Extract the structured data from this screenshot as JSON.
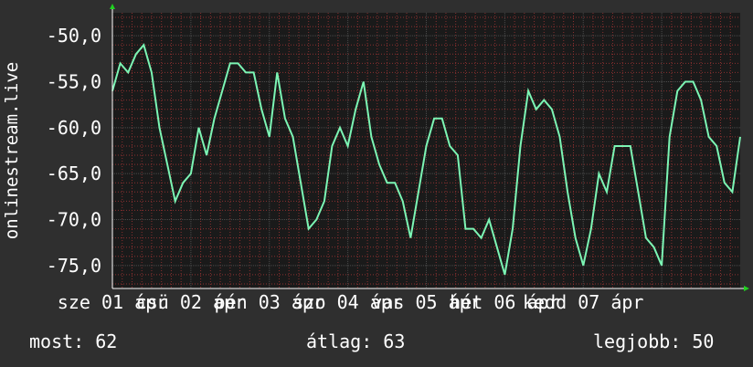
{
  "ylabel": "onlinestream.live",
  "footer": {
    "current": "most: 62",
    "average": "átlag: 63",
    "best": "legjobb: 50"
  },
  "colors": {
    "background": "#2f2f2f",
    "plot_background": "#1a1a1a",
    "line": "#7cf5b4",
    "grid_major": "#4a4a4a",
    "grid_minor": "#8a3030",
    "axis_arrow": "#20d020"
  },
  "chart_data": {
    "type": "line",
    "title": "",
    "xlabel": "",
    "ylabel": "onlinestream.live",
    "ylim": [
      -77.5,
      -47.5
    ],
    "yticks": [
      -50,
      -55,
      -60,
      -65,
      -70,
      -75
    ],
    "ytick_labels": [
      "-50,0",
      "-55,0",
      "-60,0",
      "-65,0",
      "-70,0",
      "-75,0"
    ],
    "xlim": [
      0,
      8
    ],
    "xticks": [
      0,
      1,
      2,
      3,
      4,
      5,
      6,
      7
    ],
    "xtick_labels": [
      "sze 01 ápr",
      "csü 02 ápr",
      "pén 03 ápr",
      "szo 04 ápr",
      "vas 05 ápr",
      "hét 06 ápr",
      "kedd 07 ápr"
    ],
    "grid": true,
    "legend": "none",
    "series": [
      {
        "x": [
          0,
          0.1,
          0.2,
          0.3,
          0.4,
          0.5,
          0.6,
          0.7,
          0.8,
          0.9,
          1.0,
          1.1,
          1.2,
          1.3,
          1.4,
          1.5,
          1.6,
          1.7,
          1.8,
          1.9,
          2.0,
          2.1,
          2.2,
          2.3,
          2.4,
          2.5,
          2.6,
          2.7,
          2.8,
          2.9,
          3.0,
          3.1,
          3.2,
          3.3,
          3.4,
          3.5,
          3.6,
          3.7,
          3.8,
          3.9,
          4.0,
          4.1,
          4.2,
          4.3,
          4.4,
          4.5,
          4.6,
          4.7,
          4.8,
          4.9,
          5.0,
          5.1,
          5.2,
          5.3,
          5.4,
          5.5,
          5.6,
          5.7,
          5.8,
          5.9,
          6.0,
          6.1,
          6.2,
          6.3,
          6.4,
          6.5,
          6.6,
          6.7,
          6.8,
          6.9,
          7.0,
          7.1,
          7.2,
          7.3,
          7.4,
          7.5,
          7.6,
          7.7,
          7.8,
          7.9,
          8.0
        ],
        "values": [
          -56,
          -53,
          -54,
          -52,
          -51,
          -54,
          -60,
          -64,
          -68,
          -66,
          -65,
          -60,
          -63,
          -59,
          -56,
          -53,
          -53,
          -54,
          -54,
          -58,
          -61,
          -54,
          -59,
          -61,
          -66,
          -71,
          -70,
          -68,
          -62,
          -60,
          -62,
          -58,
          -55,
          -61,
          -64,
          -66,
          -66,
          -68,
          -72,
          -67,
          -62,
          -59,
          -59,
          -62,
          -63,
          -71,
          -71,
          -72,
          -70,
          -73,
          -76,
          -71,
          -62,
          -56,
          -58,
          -57,
          -58,
          -61,
          -67,
          -72,
          -75,
          -71,
          -65,
          -67,
          -62,
          -62,
          -62,
          -67,
          -72,
          -73,
          -75,
          -61,
          -56,
          -55,
          -55,
          -57,
          -61,
          -62,
          -66,
          -67,
          -61
        ]
      }
    ]
  }
}
